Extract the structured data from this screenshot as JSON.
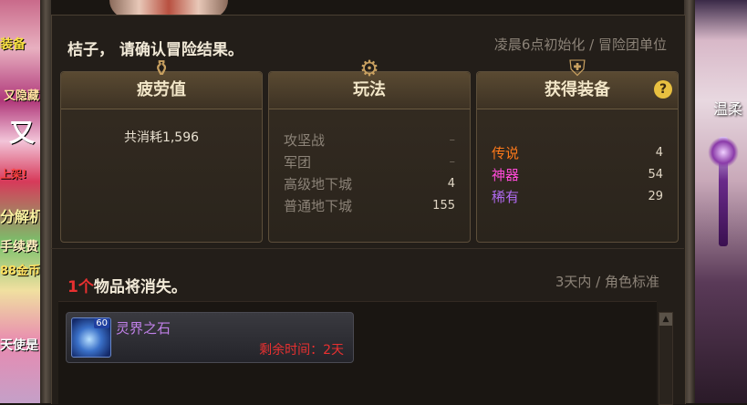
{
  "background": {
    "left_promos": [
      "装备",
      "又隐藏",
      "又",
      "上架!",
      "分解机",
      "手续费",
      "88金币",
      "天使是"
    ],
    "right_name": "温柔"
  },
  "header": {
    "greeting": "桔子， 请确认冒险结果。",
    "reset_info": "凌晨6点初始化 / 冒险团单位"
  },
  "cards": {
    "fatigue": {
      "title": "疲劳值",
      "text": "共消耗1,596"
    },
    "play": {
      "title": "玩法",
      "rows": [
        {
          "label": "攻坚战",
          "value": "–"
        },
        {
          "label": "军团",
          "value": "–"
        },
        {
          "label": "高级地下城",
          "value": "4"
        },
        {
          "label": "普通地下城",
          "value": "155"
        }
      ]
    },
    "gear": {
      "title": "获得装备",
      "help": "?",
      "rows": [
        {
          "label": "传说",
          "value": "4",
          "color": "#ff7a1a"
        },
        {
          "label": "神器",
          "value": "54",
          "color": "#ff4ad8"
        },
        {
          "label": "稀有",
          "value": "29",
          "color": "#b06af0"
        }
      ]
    }
  },
  "vanish": {
    "count": "1个",
    "text": "物品将消失。",
    "right": "3天内 / 角色标准"
  },
  "items": [
    {
      "name": "灵界之石",
      "level": "60",
      "time": "剩余时间：2天"
    }
  ]
}
